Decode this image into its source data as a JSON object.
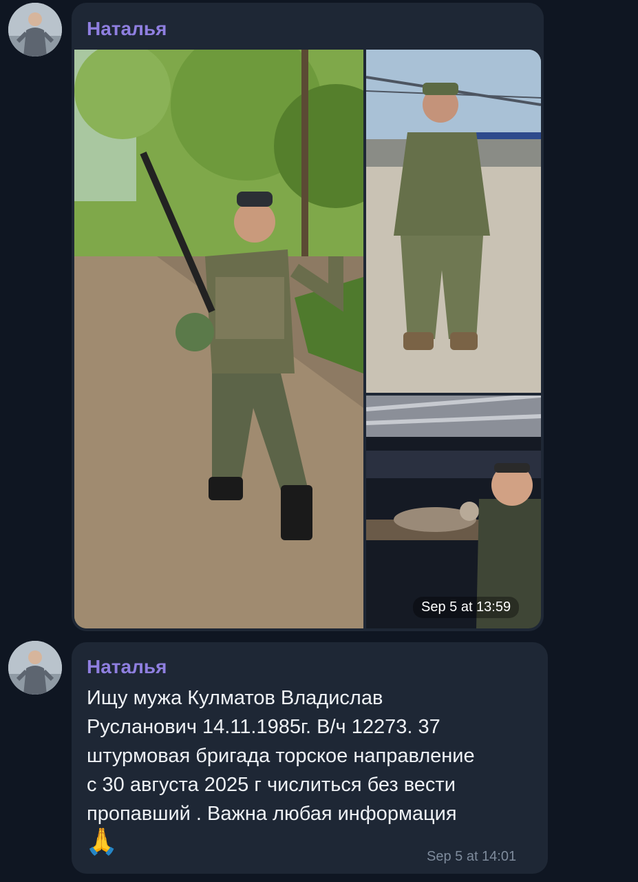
{
  "messages": [
    {
      "sender": "Наталья",
      "time": "Sep 5 at 13:59",
      "photos": [
        {
          "id": "photo-forest-soldier"
        },
        {
          "id": "photo-train-platform"
        },
        {
          "id": "photo-dugout-cat"
        }
      ]
    },
    {
      "sender": "Наталья",
      "text": "Ищу мужа Кулматов Владислав\nРусланович 14.11.1985г. В/ч 12273.   37\nштурмовая бригада торское направление\n с 30 августа 2025 г числиться без вести\nпропавший . Важна любая информация",
      "emoji": "🙏",
      "time": "Sep 5 at 14:01"
    }
  ],
  "colors": {
    "background": "#0f1622",
    "bubble": "#1e2735",
    "sender_name": "#8f7fe0",
    "timestamp": "#7e8b9c"
  }
}
